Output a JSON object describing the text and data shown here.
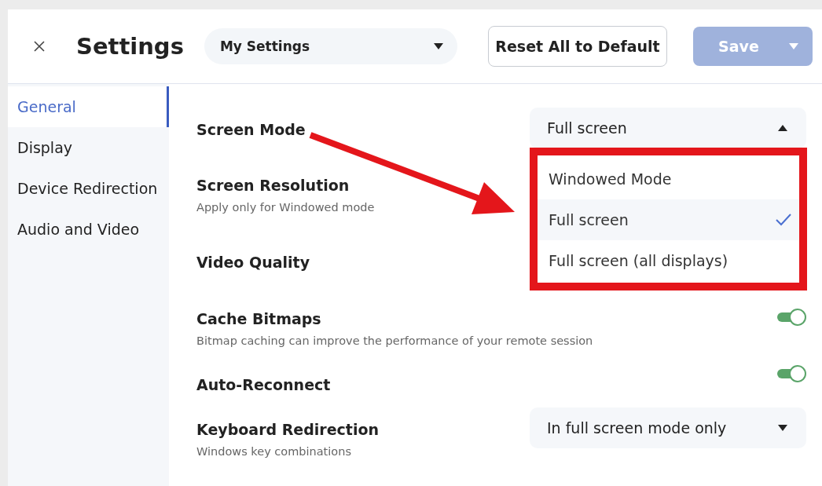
{
  "header": {
    "title": "Settings",
    "profile_select": {
      "value": "My Settings"
    },
    "buttons": [
      {
        "label": "Reset All to Default",
        "kind": "outline",
        "disabled": false
      },
      {
        "label": "Save",
        "kind": "split",
        "disabled": true
      }
    ]
  },
  "sidebar": {
    "items": [
      {
        "label": "General",
        "selected": true
      },
      {
        "label": "Display",
        "selected": false
      },
      {
        "label": "Device Redirection",
        "selected": false
      },
      {
        "label": "Audio and Video",
        "selected": false
      }
    ]
  },
  "settings": [
    {
      "label": "Screen Mode",
      "kind": "select",
      "value": "Full screen",
      "expanded": true,
      "options": [
        {
          "label": "Windowed Mode",
          "selected": false
        },
        {
          "label": "Full screen",
          "selected": true
        },
        {
          "label": "Full screen (all displays)",
          "selected": false
        }
      ]
    },
    {
      "label": "Screen Resolution",
      "description": "Apply only for Windowed mode",
      "kind": "plain"
    },
    {
      "label": "Video Quality",
      "kind": "plain"
    },
    {
      "label": "Cache Bitmaps",
      "description": "Bitmap caching can improve the performance of your remote session",
      "kind": "toggle",
      "on": true
    },
    {
      "label": "Auto-Reconnect",
      "kind": "toggle",
      "on": true
    },
    {
      "label": "Keyboard Redirection",
      "description": "Windows key combinations",
      "kind": "select",
      "value": "In full screen mode only",
      "expanded": false
    }
  ]
}
